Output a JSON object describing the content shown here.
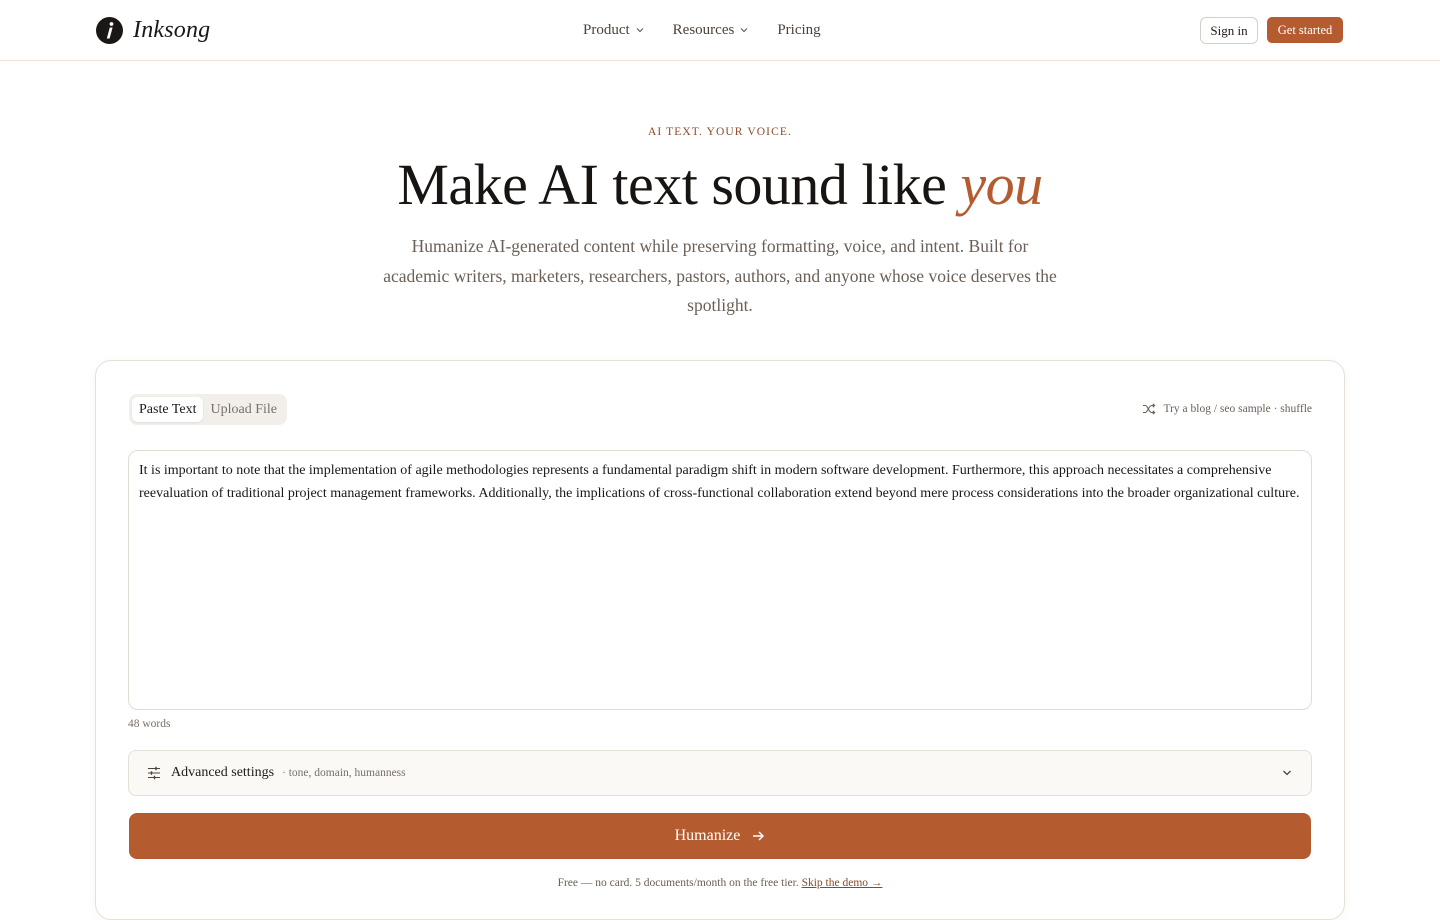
{
  "brand": {
    "name": "Inksong",
    "mark_letter": "i",
    "accent_color": "#b45b2f",
    "mark_color": "#1a1715"
  },
  "nav": {
    "items": [
      {
        "label": "Product",
        "has_dropdown": true
      },
      {
        "label": "Resources",
        "has_dropdown": true
      },
      {
        "label": "Pricing",
        "has_dropdown": false
      }
    ],
    "sign_in": "Sign in",
    "get_started": "Get started"
  },
  "hero": {
    "eyebrow": "AI TEXT. YOUR VOICE.",
    "headline_main": "Make AI text sound like ",
    "headline_accent": "you",
    "subcopy": "Humanize AI-generated content while preserving formatting, voice, and intent. Built for academic writers, marketers, researchers, pastors, authors, and anyone whose voice deserves the spotlight."
  },
  "tool": {
    "tabs": [
      {
        "label": "Paste Text",
        "active": true
      },
      {
        "label": "Upload File",
        "active": false
      }
    ],
    "sample_link": "Try a blog / seo sample · shuffle",
    "input_text": "It is important to note that the implementation of agile methodologies represents a fundamental paradigm shift in modern software development. Furthermore, this approach necessitates a comprehensive reevaluation of traditional project management frameworks. Additionally, the implications of cross-functional collaboration extend beyond mere process considerations into the broader organizational culture.",
    "word_count": "48 words",
    "advanced": {
      "label": "Advanced settings",
      "hint": "· tone, domain, humanness"
    },
    "humanize_label": "Humanize",
    "footnote_text": "Free — no card. 5 documents/month on the free tier. ",
    "footnote_link": "Skip the demo →"
  }
}
